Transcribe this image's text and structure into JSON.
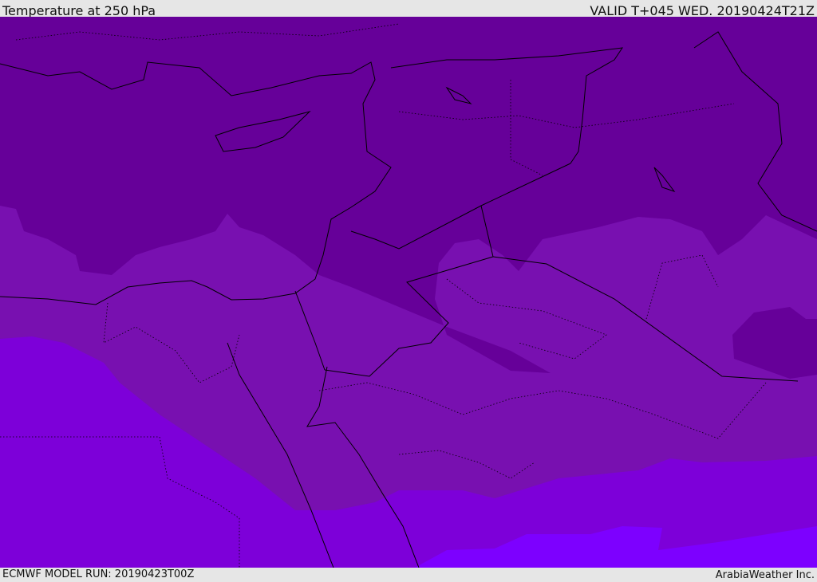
{
  "header": {
    "title": "Temperature at 250 hPa",
    "valid": "VALID T+045 WED. 20190424T21Z"
  },
  "footer": {
    "model_run": "ECMWF MODEL RUN: 20190423T00Z",
    "credit": "ArabiaWeather Inc."
  },
  "colors": {
    "band_coldest": "#660099",
    "band_cold": "#7810b0",
    "band_mid": "#7d00d9",
    "band_warm": "#7d00ff",
    "background": "#e6e6e6"
  }
}
